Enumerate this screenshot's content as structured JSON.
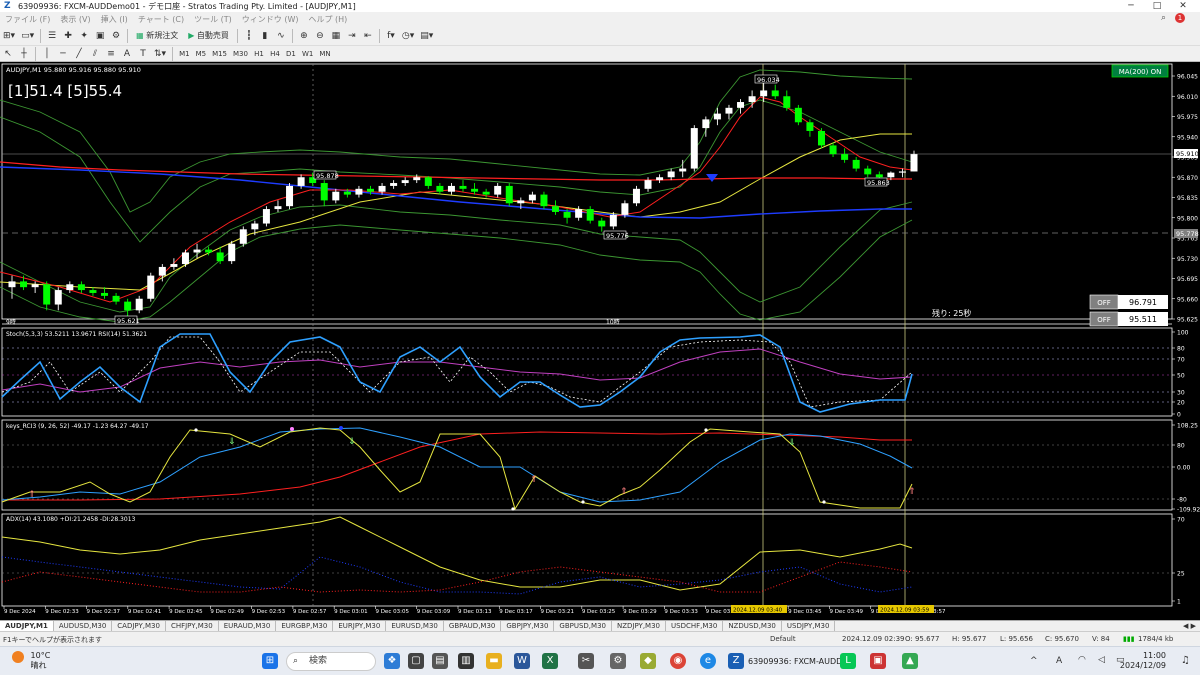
{
  "window": {
    "title": "63909936: FXCM-AUDDemo01 - デモ口座 - Stratos Trading Pty. Limited - [AUDJPY,M1]"
  },
  "menu": [
    "ファイル (F)",
    "表示 (V)",
    "挿入 (I)",
    "チャート (C)",
    "ツール (T)",
    "ウィンドウ (W)",
    "ヘルプ (H)"
  ],
  "toolbar": {
    "new_order": "新規注文",
    "auto_trade": "自動売買"
  },
  "timeframes": [
    "M1",
    "M5",
    "M15",
    "M30",
    "H1",
    "H4",
    "D1",
    "W1",
    "MN"
  ],
  "colors": {
    "bull": "#ffffff",
    "bear": "#00ff00",
    "red": "#ff2020",
    "blue": "#1e3cff",
    "yellow": "#e6e640",
    "green": "#3c9632",
    "grid": "#5a5a5a",
    "cyan": "#2ea0ff",
    "magenta": "#c040c0"
  },
  "chart": {
    "header": "AUDJPY,M1  95.880 95.916 95.880 95.910",
    "big_label": "[1]51.4 [5]55.4",
    "ma_button": "MA(200) ON",
    "price_labels": [
      "96.045",
      "96.010",
      "95.975",
      "95.940",
      "95.905",
      "95.870",
      "95.835",
      "95.800",
      "95.765",
      "95.730",
      "95.695",
      "95.660",
      "95.625"
    ],
    "current_price": "95.910",
    "line_price": "95.778",
    "annotations": [
      "96.034",
      "95.878",
      "95.776",
      "95.863",
      "95.621"
    ],
    "panel_buttons": [
      {
        "state": "OFF",
        "value": "96.791"
      },
      {
        "state": "OFF",
        "value": "95.511"
      }
    ],
    "remaining": "残り: 25秒",
    "day_labels": [
      "9時",
      "10時"
    ],
    "stoch_label": "Stoch(5,3,3) 53.5211 13.9671  RSI(14) 51.3621",
    "stoch_levels": [
      "100",
      "80",
      "70",
      "50",
      "30",
      "20",
      "0"
    ],
    "rci_label": "keys_RCI3 (9, 26, 52) -49.17 -1.23 64.27 -49.17",
    "rci_levels": [
      "108.25",
      "80",
      "0.00",
      "-80",
      "-109.92"
    ],
    "adx_label": "ADX(14) 43.1080 +DI:21.2458 -DI:28.3013",
    "adx_levels": [
      "70",
      "25",
      "1"
    ],
    "time_labels": [
      "9 Dec 2024",
      "9 Dec 02:33",
      "9 Dec 02:37",
      "9 Dec 02:41",
      "9 Dec 02:45",
      "9 Dec 02:49",
      "9 Dec 02:53",
      "9 Dec 02:57",
      "9 Dec 03:01",
      "9 Dec 03:05",
      "9 Dec 03:09",
      "9 Dec 03:13",
      "9 Dec 03:17",
      "9 Dec 03:21",
      "9 Dec 03:25",
      "9 Dec 03:29",
      "9 Dec 03:33",
      "9 Dec 03:37",
      "9 Dec 03:41",
      "9 Dec 03:45",
      "9 Dec 03:49",
      "9 Dec 03:53",
      "9 Dec 03:57"
    ],
    "cursor_labels": [
      "2024.12.09 03:40",
      "2024.12.09 03:59"
    ]
  },
  "tabs": [
    "AUDJPY,M1",
    "AUDUSD,M30",
    "CADJPY,M30",
    "CHFJPY,M30",
    "EURAUD,M30",
    "EURGBP,M30",
    "EURJPY,M30",
    "EURUSD,M30",
    "GBPAUD,M30",
    "GBPJPY,M30",
    "GBPUSD,M30",
    "NZDJPY,M30",
    "USDCHF,M30",
    "NZDUSD,M30",
    "USDJPY,M30"
  ],
  "status": {
    "help": "F1キーでヘルプが表示されます",
    "profile": "Default",
    "datetime": "2024.12.09 02:39",
    "open": "O: 95.677",
    "high": "H: 95.677",
    "low": "L: 95.656",
    "close": "C: 95.670",
    "volume": "V: 84",
    "traffic": "1784/4 kb"
  },
  "taskbar": {
    "temp": "10°C",
    "weather": "晴れ",
    "search": "検索",
    "app_label": "63909936: FXCM-AUDD",
    "time": "11:00",
    "date": "2024/12/09",
    "ime": "A"
  },
  "chart_data": {
    "type": "line",
    "candles": [
      [
        95.68,
        95.7,
        95.66,
        95.69
      ],
      [
        95.69,
        95.7,
        95.675,
        95.68
      ],
      [
        95.68,
        95.69,
        95.67,
        95.685
      ],
      [
        95.685,
        95.69,
        95.64,
        95.65
      ],
      [
        95.65,
        95.68,
        95.64,
        95.675
      ],
      [
        95.675,
        95.69,
        95.67,
        95.685
      ],
      [
        95.685,
        95.69,
        95.67,
        95.675
      ],
      [
        95.675,
        95.68,
        95.665,
        95.67
      ],
      [
        95.67,
        95.68,
        95.66,
        95.665
      ],
      [
        95.665,
        95.67,
        95.65,
        95.655
      ],
      [
        95.655,
        95.66,
        95.63,
        95.64
      ],
      [
        95.64,
        95.665,
        95.635,
        95.66
      ],
      [
        95.66,
        95.705,
        95.655,
        95.7
      ],
      [
        95.7,
        95.72,
        95.69,
        95.715
      ],
      [
        95.715,
        95.73,
        95.71,
        95.72
      ],
      [
        95.72,
        95.745,
        95.715,
        95.74
      ],
      [
        95.74,
        95.755,
        95.73,
        95.745
      ],
      [
        95.745,
        95.75,
        95.735,
        95.74
      ],
      [
        95.74,
        95.75,
        95.72,
        95.725
      ],
      [
        95.725,
        95.76,
        95.72,
        95.755
      ],
      [
        95.755,
        95.785,
        95.75,
        95.78
      ],
      [
        95.78,
        95.795,
        95.77,
        95.79
      ],
      [
        95.79,
        95.82,
        95.785,
        95.815
      ],
      [
        95.815,
        95.83,
        95.81,
        95.82
      ],
      [
        95.82,
        95.86,
        95.815,
        95.855
      ],
      [
        95.855,
        95.875,
        95.85,
        95.87
      ],
      [
        95.87,
        95.878,
        95.855,
        95.86
      ],
      [
        95.86,
        95.865,
        95.82,
        95.83
      ],
      [
        95.83,
        95.85,
        95.825,
        95.845
      ],
      [
        95.845,
        95.85,
        95.835,
        95.84
      ],
      [
        95.84,
        95.855,
        95.835,
        95.85
      ],
      [
        95.85,
        95.855,
        95.84,
        95.845
      ],
      [
        95.845,
        95.86,
        95.84,
        95.855
      ],
      [
        95.855,
        95.865,
        95.85,
        95.86
      ],
      [
        95.86,
        95.87,
        95.855,
        95.865
      ],
      [
        95.865,
        95.875,
        95.86,
        95.87
      ],
      [
        95.87,
        95.872,
        95.85,
        95.855
      ],
      [
        95.855,
        95.86,
        95.84,
        95.845
      ],
      [
        95.845,
        95.86,
        95.84,
        95.855
      ],
      [
        95.855,
        95.865,
        95.845,
        95.85
      ],
      [
        95.85,
        95.86,
        95.84,
        95.845
      ],
      [
        95.845,
        95.85,
        95.835,
        95.84
      ],
      [
        95.84,
        95.86,
        95.835,
        95.855
      ],
      [
        95.855,
        95.86,
        95.82,
        95.825
      ],
      [
        95.825,
        95.835,
        95.815,
        95.83
      ],
      [
        95.83,
        95.845,
        95.825,
        95.84
      ],
      [
        95.84,
        95.845,
        95.815,
        95.82
      ],
      [
        95.82,
        95.83,
        95.805,
        95.81
      ],
      [
        95.81,
        95.815,
        95.79,
        95.8
      ],
      [
        95.8,
        95.82,
        95.795,
        95.815
      ],
      [
        95.815,
        95.82,
        95.79,
        95.795
      ],
      [
        95.795,
        95.8,
        95.776,
        95.785
      ],
      [
        95.785,
        95.81,
        95.78,
        95.805
      ],
      [
        95.805,
        95.83,
        95.8,
        95.825
      ],
      [
        95.825,
        95.855,
        95.82,
        95.85
      ],
      [
        95.85,
        95.87,
        95.845,
        95.865
      ],
      [
        95.865,
        95.875,
        95.86,
        95.87
      ],
      [
        95.87,
        95.885,
        95.865,
        95.88
      ],
      [
        95.88,
        95.9,
        95.87,
        95.885
      ],
      [
        95.885,
        95.96,
        95.88,
        95.955
      ],
      [
        95.955,
        95.975,
        95.94,
        95.97
      ],
      [
        95.97,
        95.99,
        95.96,
        95.98
      ],
      [
        95.98,
        95.995,
        95.97,
        95.99
      ],
      [
        95.99,
        96.005,
        95.98,
        96.0
      ],
      [
        96.0,
        96.02,
        95.99,
        96.01
      ],
      [
        96.01,
        96.034,
        96.0,
        96.02
      ],
      [
        96.02,
        96.03,
        96.005,
        96.01
      ],
      [
        96.01,
        96.02,
        95.985,
        95.99
      ],
      [
        95.99,
        95.995,
        95.96,
        95.965
      ],
      [
        95.965,
        95.97,
        95.94,
        95.95
      ],
      [
        95.95,
        95.955,
        95.92,
        95.925
      ],
      [
        95.925,
        95.93,
        95.905,
        95.91
      ],
      [
        95.91,
        95.92,
        95.895,
        95.9
      ],
      [
        95.9,
        95.905,
        95.88,
        95.885
      ],
      [
        95.885,
        95.89,
        95.87,
        95.875
      ],
      [
        95.875,
        95.88,
        95.863,
        95.87
      ],
      [
        95.87,
        95.88,
        95.865,
        95.878
      ],
      [
        95.878,
        95.885,
        95.87,
        95.88
      ],
      [
        95.88,
        95.916,
        95.88,
        95.91
      ]
    ]
  }
}
